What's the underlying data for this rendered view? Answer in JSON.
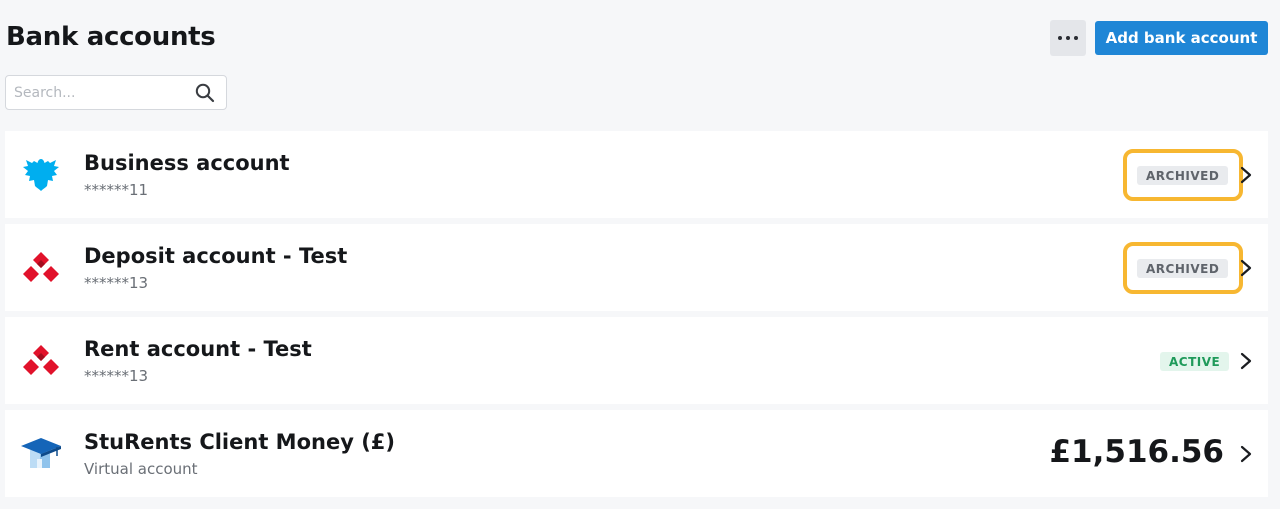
{
  "header": {
    "title": "Bank accounts",
    "more_label": "more-options",
    "add_button_label": "Add bank account"
  },
  "search": {
    "placeholder": "Search...",
    "value": ""
  },
  "accounts": [
    {
      "name": "Business account",
      "sub": "******11",
      "status": "ARCHIVED",
      "icon": "barclays-eagle-icon",
      "highlighted": true
    },
    {
      "name": "Deposit account - Test",
      "sub": "******13",
      "status": "ARCHIVED",
      "icon": "natwest-logo-icon",
      "highlighted": true
    },
    {
      "name": "Rent account - Test",
      "sub": "******13",
      "status": "ACTIVE",
      "icon": "natwest-logo-icon",
      "highlighted": false
    },
    {
      "name": "StuRents Client Money (£)",
      "sub": "Virtual account",
      "amount": "£1,516.56",
      "icon": "graduation-cap-house-icon"
    }
  ],
  "colors": {
    "accent": "#1f86d6",
    "highlight": "#f7b731",
    "active_text": "#1f9a5a",
    "archived_text": "#5f646b",
    "barclays": "#00aeef",
    "natwest": "#e1122b"
  }
}
